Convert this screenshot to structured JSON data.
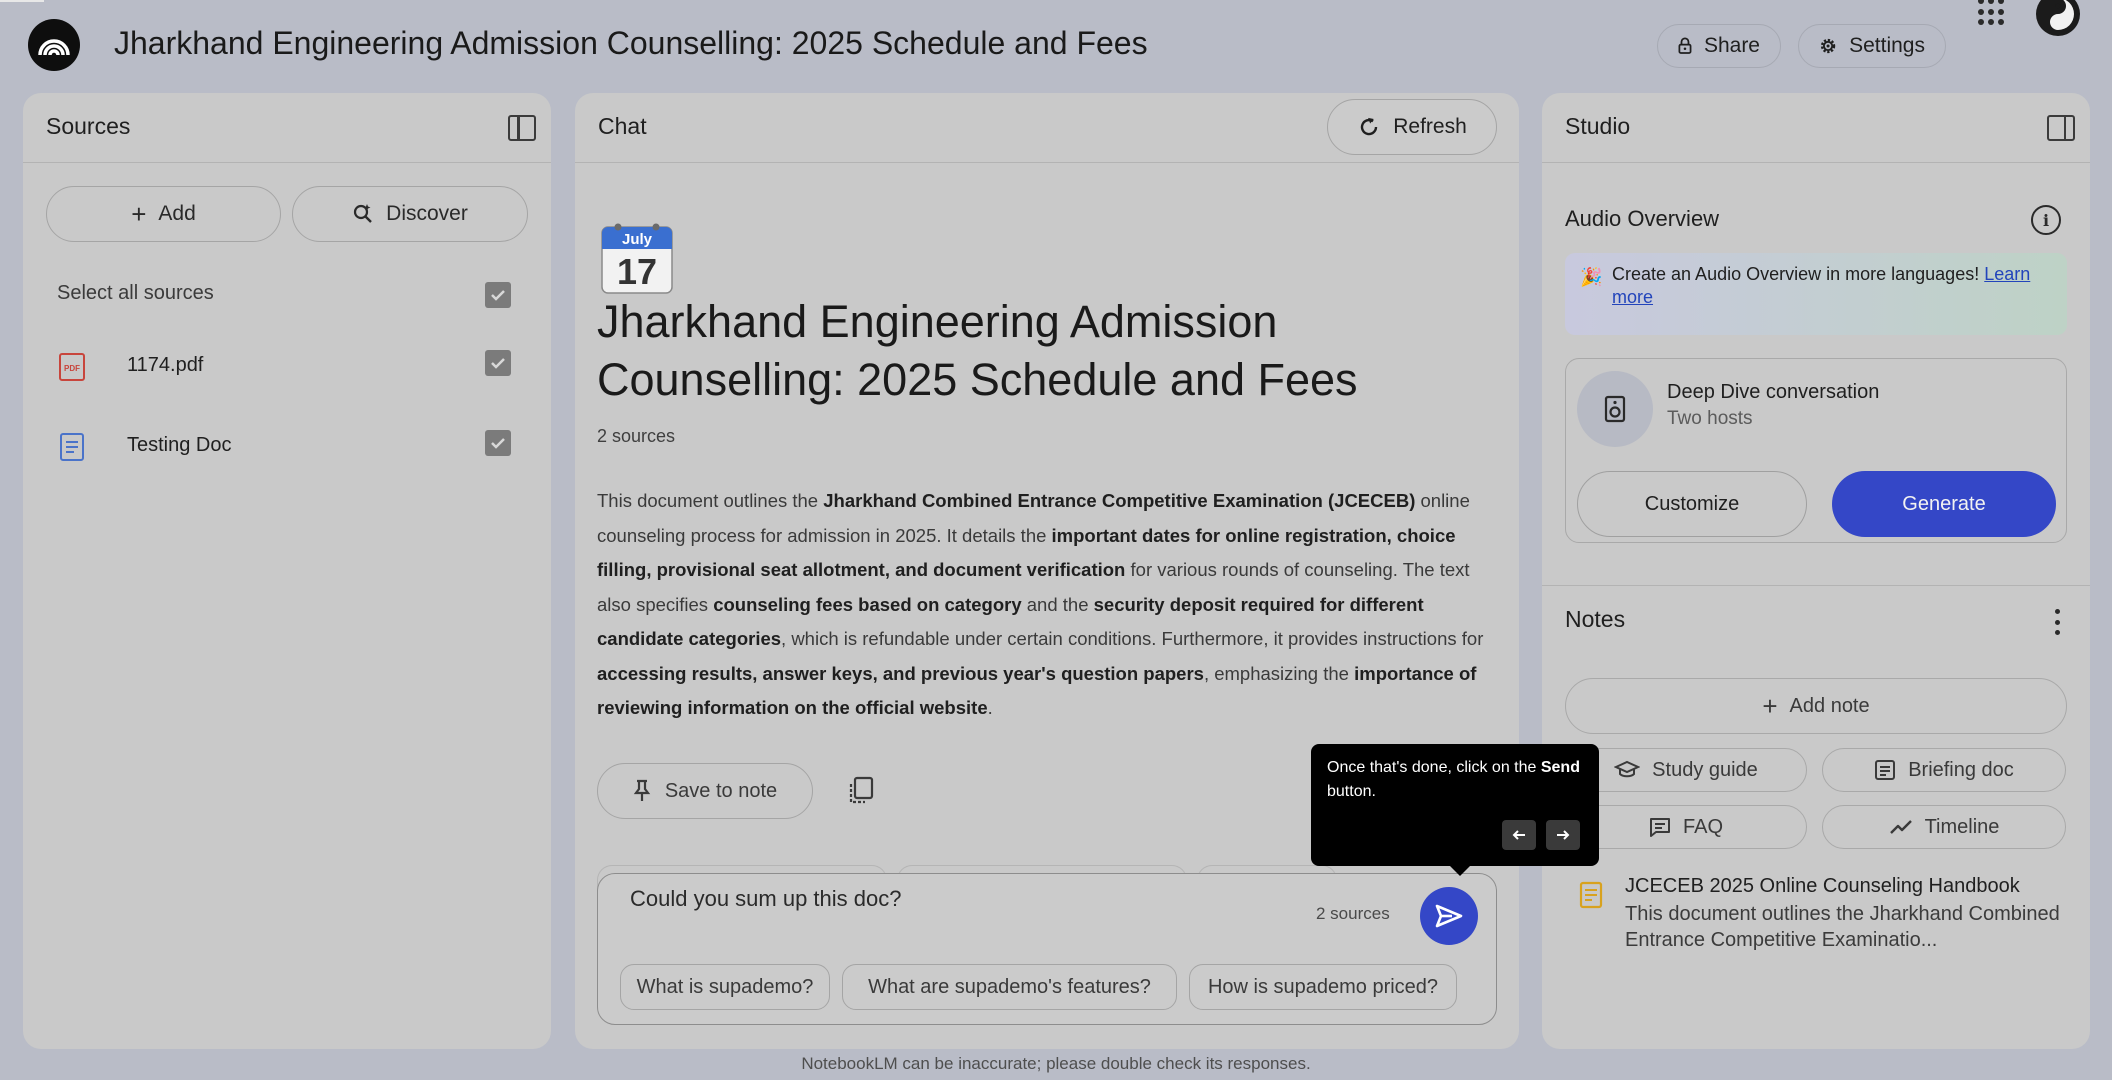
{
  "header": {
    "title": "Jharkhand Engineering Admission Counselling: 2025 Schedule and Fees",
    "share_label": "Share",
    "settings_label": "Settings"
  },
  "sources_panel": {
    "title": "Sources",
    "add_label": "Add",
    "discover_label": "Discover",
    "select_all_label": "Select all sources",
    "items": [
      {
        "label": "1174.pdf",
        "icon": "pdf-icon",
        "checked": true
      },
      {
        "label": "Testing Doc",
        "icon": "doc-icon",
        "checked": true
      }
    ]
  },
  "chat_panel": {
    "title": "Chat",
    "refresh_label": "Refresh",
    "calendar_month": "July",
    "calendar_day": "17",
    "heading": "Jharkhand Engineering Admission Counselling: 2025 Schedule and Fees",
    "source_count": "2 sources",
    "summary": {
      "p1": "This document outlines the ",
      "b1": "Jharkhand Combined Entrance Competitive Examination (JCECEB)",
      "p2": " online counseling process for admission in 2025. It details the ",
      "b2": "important dates for online registration, choice filling, provisional seat allotment, and document verification",
      "p3": " for various rounds of counseling. The text also specifies ",
      "b3": "counseling fees based on category",
      "p4": " and the ",
      "b4": "security deposit required for different candidate categories",
      "p5": ", which is refundable under certain conditions. Furthermore, it provides instructions for ",
      "b5": "accessing results, answer keys, and previous year's question papers",
      "p6": ", emphasizing the ",
      "b6": "importance of reviewing information on the official website",
      "p7": "."
    },
    "save_to_note_label": "Save to note",
    "composer": {
      "value": "Could you sum up this doc?",
      "source_count": "2 sources",
      "suggestions": [
        "What is supademo?",
        "What are supademo's features?",
        "How is supademo priced?"
      ]
    }
  },
  "tooltip": {
    "text_before": "Once that's done, click on the ",
    "text_bold": "Send",
    "text_after": " button."
  },
  "studio_panel": {
    "title": "Studio",
    "audio_overview_title": "Audio Overview",
    "promo_text": "Create an Audio Overview in more languages!",
    "promo_link": "Learn more",
    "deep_dive_title": "Deep Dive conversation",
    "deep_dive_sub": "Two hosts",
    "customize_label": "Customize",
    "generate_label": "Generate",
    "notes_title": "Notes",
    "add_note_label": "Add note",
    "tools": [
      "Study guide",
      "Briefing doc",
      "FAQ",
      "Timeline"
    ],
    "note": {
      "title": "JCECEB 2025 Online Counseling Handbook",
      "preview": "This document outlines the Jharkhand Combined Entrance Competitive Examinatio..."
    }
  },
  "footer": {
    "disclaimer": "NotebookLM can be inaccurate; please double check its responses."
  },
  "colors": {
    "accent": "#3447c7",
    "background": "#b9bcc7",
    "panel": "#c9c9c9"
  }
}
